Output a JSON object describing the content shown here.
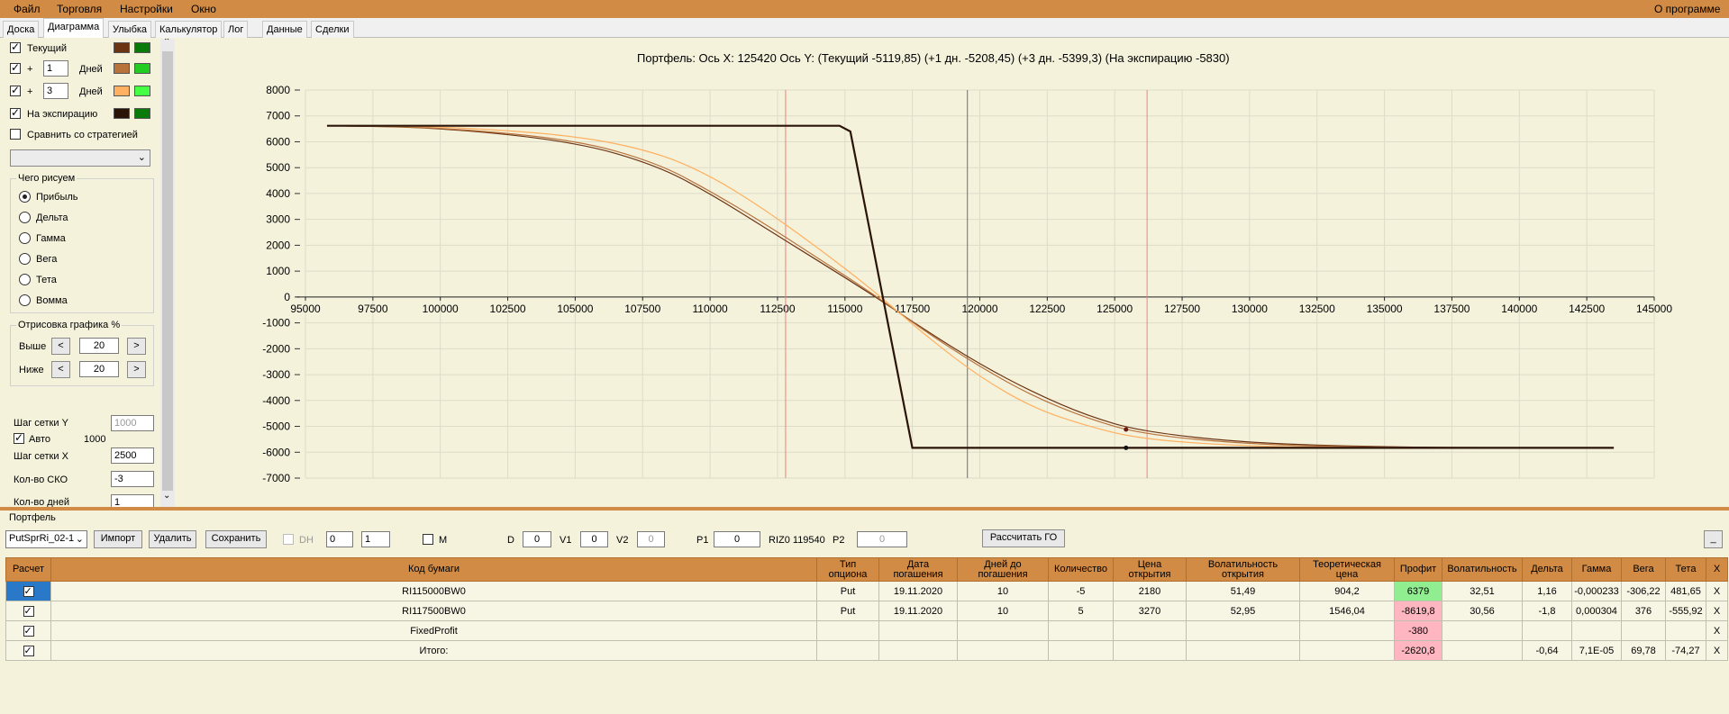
{
  "menu": {
    "file": "Файл",
    "trade": "Торговля",
    "settings": "Настройки",
    "window": "Окно",
    "about": "О программе"
  },
  "tabs": [
    "Доска",
    "Диаграмма",
    "Улыбка",
    "Калькулятор",
    "Лог",
    "Данные",
    "Сделки"
  ],
  "left": {
    "current": "Текущий",
    "plus": "+",
    "days1": "1",
    "days3": "3",
    "days_label": "Дней",
    "expiry": "На экспирацию",
    "compare": "Сравнить со стратегией",
    "what_draw": "Чего рисуем",
    "options": [
      "Прибыль",
      "Дельта",
      "Гамма",
      "Вега",
      "Тета",
      "Вомма"
    ],
    "render": "Отрисовка графика %",
    "above": "Выше",
    "below": "Ниже",
    "above_val": "20",
    "below_val": "20",
    "lt": "<",
    "gt": ">",
    "grid_y": "Шаг сетки Y",
    "grid_y_val": "1000",
    "auto": "Авто",
    "auto_val": "1000",
    "grid_x": "Шаг сетки X",
    "grid_x_val": "2500",
    "sko": "Кол-во СКО",
    "sko_val": "-3",
    "days_cut": "Кол-во дней",
    "days_cut_val": "1"
  },
  "chart_title": "Портфель: Ось X: 125420 Ось Y: (Текущий -5119,85) (+1 дн. -5208,45) (+3 дн. -5399,3) (На экспирацию -5830)",
  "colors": {
    "current": [
      "#6b3413",
      "#0a7a0a"
    ],
    "day1": [
      "#b8733d",
      "#22cc22"
    ],
    "day3": [
      "#ffb060",
      "#44ff44"
    ],
    "expiry": [
      "#2a1408",
      "#0a7a0a"
    ]
  },
  "chart_data": {
    "type": "line",
    "xlim": [
      95000,
      145000
    ],
    "ylim": [
      -7000,
      8000
    ],
    "x_ticks": [
      "95000",
      "97500",
      "100000",
      "102500",
      "105000",
      "107500",
      "110000",
      "112500",
      "115000",
      "117500",
      "120000",
      "122500",
      "125000",
      "127500",
      "130000",
      "132500",
      "135000",
      "137500",
      "140000",
      "142500",
      "145000"
    ],
    "y_ticks": [
      "8000",
      "7000",
      "6000",
      "5000",
      "4000",
      "3000",
      "2000",
      "1000",
      "0",
      "-1000",
      "-2000",
      "-3000",
      "-4000",
      "-5000",
      "-6000",
      "-7000"
    ],
    "cursor_x": 125420,
    "current_price_x": 119540,
    "sd_lines_x": [
      112800,
      126200
    ],
    "series": [
      {
        "name": "Текущий",
        "x": [
          95800,
          100000,
          105000,
          108000,
          110000,
          112000,
          114000,
          116000,
          118000,
          120000,
          122000,
          124000,
          126000,
          130000,
          135000,
          140000,
          143500
        ],
        "values": [
          6620,
          6550,
          6000,
          5100,
          4000,
          2700,
          1400,
          100,
          -1300,
          -2600,
          -3700,
          -4600,
          -5200,
          -5650,
          -5800,
          -5830,
          -5830
        ]
      },
      {
        "name": "+1 дн.",
        "x": [
          95800,
          100000,
          105000,
          108000,
          110000,
          112000,
          114000,
          116000,
          118000,
          120000,
          122000,
          124000,
          126000,
          130000,
          135000,
          140000,
          143500
        ],
        "values": [
          6620,
          6560,
          6080,
          5200,
          4100,
          2850,
          1500,
          150,
          -1350,
          -2700,
          -3850,
          -4700,
          -5300,
          -5700,
          -5820,
          -5830,
          -5830
        ]
      },
      {
        "name": "+3 дн.",
        "x": [
          95800,
          100000,
          105000,
          108000,
          110000,
          112000,
          114000,
          116000,
          118000,
          120000,
          122000,
          124000,
          126000,
          130000,
          135000,
          140000,
          143500
        ],
        "values": [
          6620,
          6600,
          6250,
          5600,
          4700,
          3400,
          1900,
          300,
          -1500,
          -3100,
          -4300,
          -5000,
          -5500,
          -5780,
          -5830,
          -5830,
          -5830
        ]
      },
      {
        "name": "На экспирацию",
        "x": [
          95800,
          114800,
          115200,
          117500,
          143500
        ],
        "values": [
          6620,
          6620,
          6400,
          -5830,
          -5830
        ]
      }
    ],
    "markers": [
      {
        "x": 125420,
        "y": -5119.85
      },
      {
        "x": 125420,
        "y": -5830
      }
    ]
  },
  "portfolio": {
    "title": "Портфель",
    "name": "PutSprRi_02-1",
    "import": "Импорт",
    "delete": "Удалить",
    "save": "Сохранить",
    "dh": "DH",
    "dh_a": "0",
    "dh_b": "1",
    "m": "M",
    "d": "D",
    "d_val": "0",
    "v1": "V1",
    "v1_val": "0",
    "v2": "V2",
    "v2_val": "0",
    "p1": "P1",
    "p1_val": "0",
    "riz": "RIZ0 119540",
    "p2": "P2",
    "p2_val": "0",
    "calc": "Рассчитать ГО",
    "minimize": "_"
  },
  "table": {
    "headers": [
      "Расчет",
      "Код бумаги",
      "Тип опциона",
      "Дата погашения",
      "Дней до погашения",
      "Количество",
      "Цена открытия",
      "Волатильность открытия",
      "Теоретическая цена",
      "Профит",
      "Волатильность",
      "Дельта",
      "Гамма",
      "Вега",
      "Тета",
      "X"
    ],
    "rows": [
      [
        "",
        "RI115000BW0",
        "Put",
        "19.11.2020",
        "10",
        "-5",
        "2180",
        "51,49",
        "904,2",
        "6379",
        "32,51",
        "1,16",
        "-0,000233",
        "-306,22",
        "481,65",
        "X"
      ],
      [
        "",
        "RI117500BW0",
        "Put",
        "19.11.2020",
        "10",
        "5",
        "3270",
        "52,95",
        "1546,04",
        "-8619,8",
        "30,56",
        "-1,8",
        "0,000304",
        "376",
        "-555,92",
        "X"
      ],
      [
        "",
        "FixedProfit",
        "",
        "",
        "",
        "",
        "",
        "",
        "",
        "-380",
        "",
        "",
        "",
        "",
        "",
        "X"
      ],
      [
        "",
        "Итого:",
        "",
        "",
        "",
        "",
        "",
        "",
        "",
        "-2620,8",
        "",
        "-0,64",
        "7,1E-05",
        "69,78",
        "-74,27",
        "X"
      ]
    ]
  }
}
